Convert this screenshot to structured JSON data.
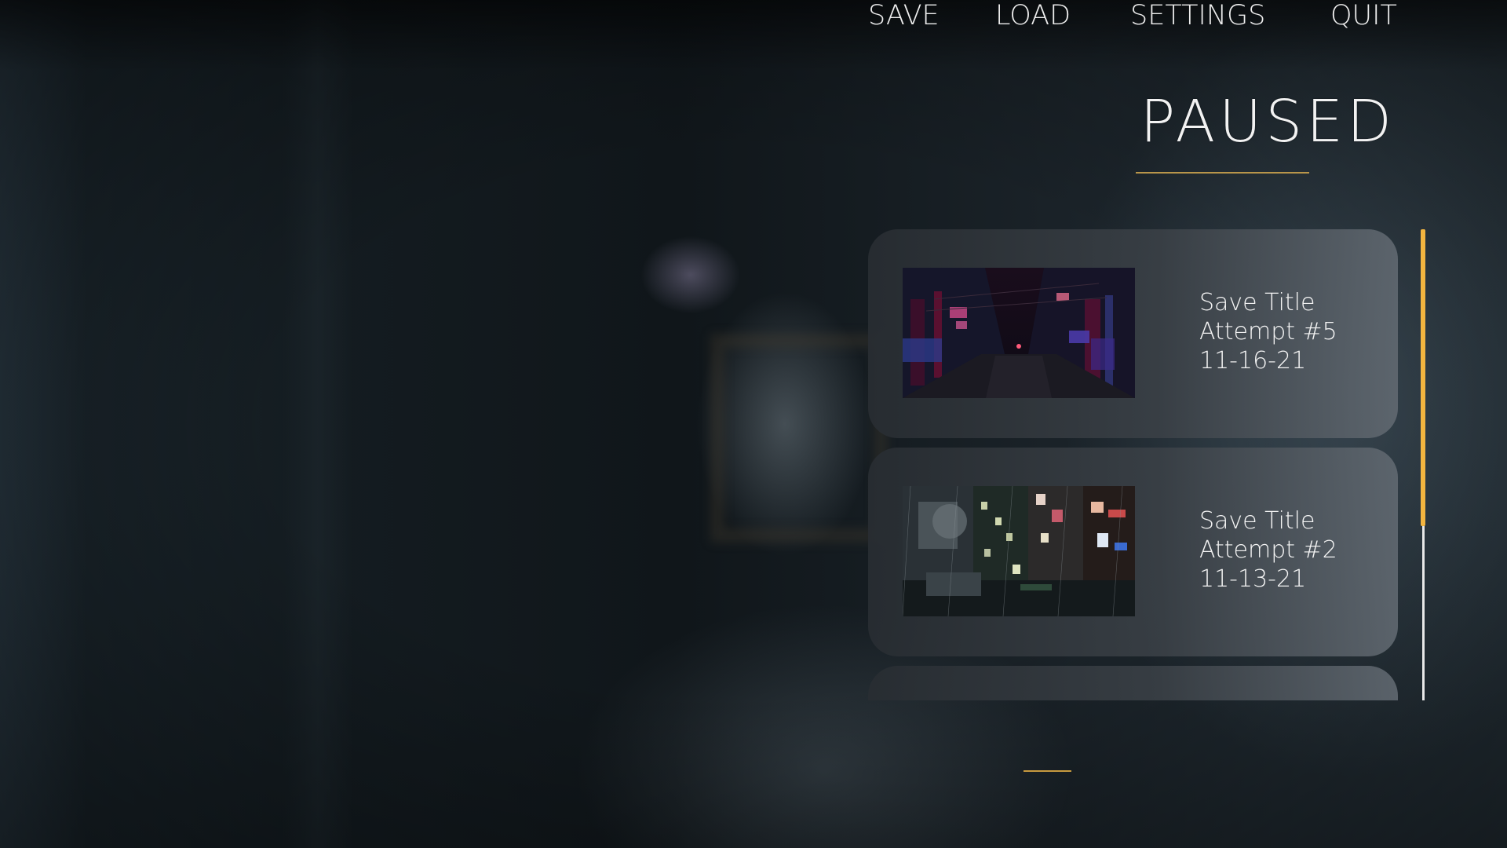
{
  "menu": {
    "title": "PAUSED",
    "accent_color": "#f3b53f",
    "underline_color": "#c79a3f"
  },
  "saves": [
    {
      "title": "Save Title",
      "subtitle": "Attempt #5",
      "date": "11-16-21",
      "thumbnail": "neon-city-street-night"
    },
    {
      "title": "Save Title",
      "subtitle": "Attempt #2",
      "date": "11-13-21",
      "thumbnail": "rainy-cyberpunk-buildings"
    }
  ],
  "scrollbar": {
    "visible_fraction": 0.63,
    "position_fraction": 0.0
  },
  "nav": {
    "items": [
      "SAVE",
      "LOAD",
      "SETTINGS",
      "QUIT"
    ],
    "active": "LOAD"
  }
}
